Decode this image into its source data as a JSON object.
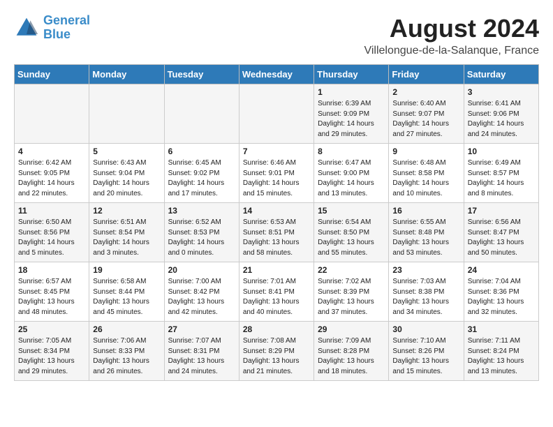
{
  "logo": {
    "line1": "General",
    "line2": "Blue"
  },
  "title": "August 2024",
  "location": "Villelongue-de-la-Salanque, France",
  "days_of_week": [
    "Sunday",
    "Monday",
    "Tuesday",
    "Wednesday",
    "Thursday",
    "Friday",
    "Saturday"
  ],
  "weeks": [
    [
      {
        "day": "",
        "info": ""
      },
      {
        "day": "",
        "info": ""
      },
      {
        "day": "",
        "info": ""
      },
      {
        "day": "",
        "info": ""
      },
      {
        "day": "1",
        "info": "Sunrise: 6:39 AM\nSunset: 9:09 PM\nDaylight: 14 hours\nand 29 minutes."
      },
      {
        "day": "2",
        "info": "Sunrise: 6:40 AM\nSunset: 9:07 PM\nDaylight: 14 hours\nand 27 minutes."
      },
      {
        "day": "3",
        "info": "Sunrise: 6:41 AM\nSunset: 9:06 PM\nDaylight: 14 hours\nand 24 minutes."
      }
    ],
    [
      {
        "day": "4",
        "info": "Sunrise: 6:42 AM\nSunset: 9:05 PM\nDaylight: 14 hours\nand 22 minutes."
      },
      {
        "day": "5",
        "info": "Sunrise: 6:43 AM\nSunset: 9:04 PM\nDaylight: 14 hours\nand 20 minutes."
      },
      {
        "day": "6",
        "info": "Sunrise: 6:45 AM\nSunset: 9:02 PM\nDaylight: 14 hours\nand 17 minutes."
      },
      {
        "day": "7",
        "info": "Sunrise: 6:46 AM\nSunset: 9:01 PM\nDaylight: 14 hours\nand 15 minutes."
      },
      {
        "day": "8",
        "info": "Sunrise: 6:47 AM\nSunset: 9:00 PM\nDaylight: 14 hours\nand 13 minutes."
      },
      {
        "day": "9",
        "info": "Sunrise: 6:48 AM\nSunset: 8:58 PM\nDaylight: 14 hours\nand 10 minutes."
      },
      {
        "day": "10",
        "info": "Sunrise: 6:49 AM\nSunset: 8:57 PM\nDaylight: 14 hours\nand 8 minutes."
      }
    ],
    [
      {
        "day": "11",
        "info": "Sunrise: 6:50 AM\nSunset: 8:56 PM\nDaylight: 14 hours\nand 5 minutes."
      },
      {
        "day": "12",
        "info": "Sunrise: 6:51 AM\nSunset: 8:54 PM\nDaylight: 14 hours\nand 3 minutes."
      },
      {
        "day": "13",
        "info": "Sunrise: 6:52 AM\nSunset: 8:53 PM\nDaylight: 14 hours\nand 0 minutes."
      },
      {
        "day": "14",
        "info": "Sunrise: 6:53 AM\nSunset: 8:51 PM\nDaylight: 13 hours\nand 58 minutes."
      },
      {
        "day": "15",
        "info": "Sunrise: 6:54 AM\nSunset: 8:50 PM\nDaylight: 13 hours\nand 55 minutes."
      },
      {
        "day": "16",
        "info": "Sunrise: 6:55 AM\nSunset: 8:48 PM\nDaylight: 13 hours\nand 53 minutes."
      },
      {
        "day": "17",
        "info": "Sunrise: 6:56 AM\nSunset: 8:47 PM\nDaylight: 13 hours\nand 50 minutes."
      }
    ],
    [
      {
        "day": "18",
        "info": "Sunrise: 6:57 AM\nSunset: 8:45 PM\nDaylight: 13 hours\nand 48 minutes."
      },
      {
        "day": "19",
        "info": "Sunrise: 6:58 AM\nSunset: 8:44 PM\nDaylight: 13 hours\nand 45 minutes."
      },
      {
        "day": "20",
        "info": "Sunrise: 7:00 AM\nSunset: 8:42 PM\nDaylight: 13 hours\nand 42 minutes."
      },
      {
        "day": "21",
        "info": "Sunrise: 7:01 AM\nSunset: 8:41 PM\nDaylight: 13 hours\nand 40 minutes."
      },
      {
        "day": "22",
        "info": "Sunrise: 7:02 AM\nSunset: 8:39 PM\nDaylight: 13 hours\nand 37 minutes."
      },
      {
        "day": "23",
        "info": "Sunrise: 7:03 AM\nSunset: 8:38 PM\nDaylight: 13 hours\nand 34 minutes."
      },
      {
        "day": "24",
        "info": "Sunrise: 7:04 AM\nSunset: 8:36 PM\nDaylight: 13 hours\nand 32 minutes."
      }
    ],
    [
      {
        "day": "25",
        "info": "Sunrise: 7:05 AM\nSunset: 8:34 PM\nDaylight: 13 hours\nand 29 minutes."
      },
      {
        "day": "26",
        "info": "Sunrise: 7:06 AM\nSunset: 8:33 PM\nDaylight: 13 hours\nand 26 minutes."
      },
      {
        "day": "27",
        "info": "Sunrise: 7:07 AM\nSunset: 8:31 PM\nDaylight: 13 hours\nand 24 minutes."
      },
      {
        "day": "28",
        "info": "Sunrise: 7:08 AM\nSunset: 8:29 PM\nDaylight: 13 hours\nand 21 minutes."
      },
      {
        "day": "29",
        "info": "Sunrise: 7:09 AM\nSunset: 8:28 PM\nDaylight: 13 hours\nand 18 minutes."
      },
      {
        "day": "30",
        "info": "Sunrise: 7:10 AM\nSunset: 8:26 PM\nDaylight: 13 hours\nand 15 minutes."
      },
      {
        "day": "31",
        "info": "Sunrise: 7:11 AM\nSunset: 8:24 PM\nDaylight: 13 hours\nand 13 minutes."
      }
    ]
  ]
}
